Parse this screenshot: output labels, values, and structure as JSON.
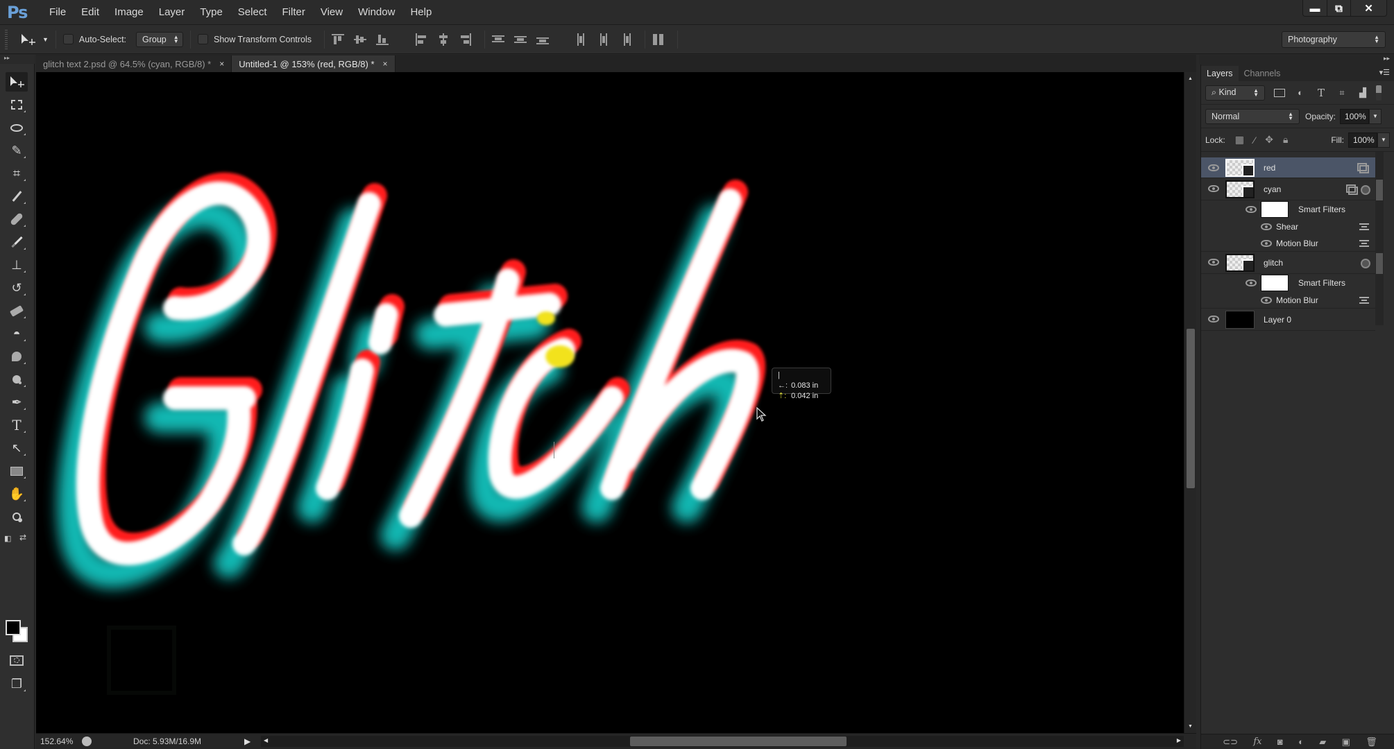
{
  "app": {
    "logo": "Ps",
    "menu": [
      "File",
      "Edit",
      "Image",
      "Layer",
      "Type",
      "Select",
      "Filter",
      "View",
      "Window",
      "Help"
    ],
    "window_controls": {
      "minimize": "▬",
      "restore": "⧉",
      "close": "✕"
    }
  },
  "options_bar": {
    "tool_icon": "move-tool-icon",
    "auto_select_label": "Auto-Select:",
    "auto_select_checked": false,
    "auto_select_mode": "Group",
    "show_transform_label": "Show Transform Controls",
    "show_transform_checked": false,
    "align_icons": [
      "align-top-edges",
      "align-vertical-centers",
      "align-bottom-edges",
      "align-left-edges",
      "align-horizontal-centers",
      "align-right-edges"
    ],
    "distribute_icons": [
      "distribute-top-edges",
      "distribute-vertical-centers",
      "distribute-bottom-edges",
      "distribute-left-edges",
      "distribute-horizontal-centers",
      "distribute-right-edges"
    ],
    "auto_align_icon": "auto-align-layers",
    "workspace": "Photography"
  },
  "tabs": [
    {
      "label": "glitch text 2.psd @ 64.5% (cyan, RGB/8) *",
      "active": false,
      "close": "×"
    },
    {
      "label": "Untitled-1 @ 153% (red, RGB/8) *",
      "active": true,
      "close": "×"
    }
  ],
  "toolbar": {
    "tools": [
      {
        "name": "move-tool",
        "glyph": "➤"
      },
      {
        "name": "rectangular-marquee-tool",
        "glyph": "⬚"
      },
      {
        "name": "lasso-tool",
        "glyph": "ℓ"
      },
      {
        "name": "quick-selection-tool",
        "glyph": "✎"
      },
      {
        "name": "crop-tool",
        "glyph": "⌗"
      },
      {
        "name": "eyedropper-tool",
        "glyph": "⁄"
      },
      {
        "name": "spot-healing-brush-tool",
        "glyph": "✚"
      },
      {
        "name": "brush-tool",
        "glyph": "✏"
      },
      {
        "name": "clone-stamp-tool",
        "glyph": "⊥"
      },
      {
        "name": "history-brush-tool",
        "glyph": "↺"
      },
      {
        "name": "eraser-tool",
        "glyph": "▱"
      },
      {
        "name": "paint-bucket-tool",
        "glyph": "◓"
      },
      {
        "name": "smudge-tool",
        "glyph": "☚"
      },
      {
        "name": "dodge-tool",
        "glyph": "●"
      },
      {
        "name": "pen-tool",
        "glyph": "✒"
      },
      {
        "name": "type-tool",
        "glyph": "T"
      },
      {
        "name": "path-selection-tool",
        "glyph": "↖"
      },
      {
        "name": "rectangle-tool",
        "glyph": "■"
      },
      {
        "name": "hand-tool",
        "glyph": "✋"
      },
      {
        "name": "zoom-tool",
        "glyph": "⚲"
      }
    ],
    "bottom_tools": [
      {
        "name": "quick-mask-mode",
        "glyph": "◎"
      },
      {
        "name": "screen-mode",
        "glyph": "❐"
      }
    ],
    "foreground_color": "#000000",
    "background_color": "#ffffff"
  },
  "canvas": {
    "artwork_text": "Glitch",
    "colors": {
      "white": "#ffffff",
      "red": "#ff1a1a",
      "cyan": "#19d9d3",
      "yellow": "#f2e21a"
    },
    "measure_tooltip": {
      "dx_icon": "|←:",
      "dx": "0.083 in",
      "dy_icon": "⇡:",
      "dy": "0.042 in"
    }
  },
  "status_bar": {
    "zoom": "152.64%",
    "doc_info": "Doc: 5.93M/16.9M",
    "menu_arrow": "▶"
  },
  "layers_panel": {
    "tabs": [
      "Layers",
      "Channels"
    ],
    "filter_kind": "Kind",
    "filter_icons": [
      "pixel-layer-filter",
      "adjustment-layer-filter",
      "type-layer-filter",
      "shape-layer-filter",
      "smart-object-filter"
    ],
    "blend_mode": "Normal",
    "opacity_label": "Opacity:",
    "opacity": "100%",
    "lock_label": "Lock:",
    "fill_label": "Fill:",
    "fill": "100%",
    "layers": [
      {
        "name": "red",
        "selected": true,
        "visible": true,
        "type": "smart-object"
      },
      {
        "name": "cyan",
        "selected": false,
        "visible": true,
        "type": "smart-object",
        "smart_filters_label": "Smart Filters",
        "filters": [
          "Shear",
          "Motion Blur"
        ]
      },
      {
        "name": "glitch",
        "selected": false,
        "visible": true,
        "type": "smart-object",
        "smart_filters_label": "Smart Filters",
        "filters": [
          "Motion Blur"
        ]
      },
      {
        "name": "Layer 0",
        "selected": false,
        "visible": true,
        "type": "pixel"
      }
    ],
    "footer_icons": [
      "link-layers",
      "add-layer-style",
      "add-mask",
      "new-adjustment-layer",
      "new-group",
      "new-layer",
      "delete-layer"
    ]
  }
}
